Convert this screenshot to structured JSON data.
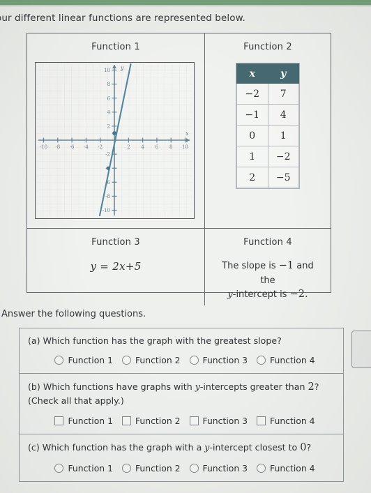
{
  "intro": "our different linear functions are represented below.",
  "functions": {
    "f1_title": "Function 1",
    "f2_title": "Function 2",
    "f3_title": "Function 3",
    "f4_title": "Function 4",
    "f3_equation": "y = 2x+5",
    "f4_line1_a": "The slope is",
    "f4_line1_b": "−1",
    "f4_line1_c": "and the",
    "f4_line2_a": "y",
    "f4_line2_b": "-intercept is",
    "f4_line2_c": "−2."
  },
  "table": {
    "headers": [
      "x",
      "y"
    ],
    "rows": [
      [
        "−2",
        "7"
      ],
      [
        "−1",
        "4"
      ],
      [
        "0",
        "1"
      ],
      [
        "1",
        "−2"
      ],
      [
        "2",
        "−5"
      ]
    ]
  },
  "chart_data": {
    "type": "line",
    "title": "Function 1",
    "xlabel": "x",
    "ylabel": "y",
    "xlim": [
      -10,
      10
    ],
    "ylim": [
      -10,
      10
    ],
    "xticks": [
      -10,
      -8,
      -6,
      -4,
      -2,
      2,
      4,
      6,
      8,
      10
    ],
    "yticks": [
      10,
      8,
      6,
      4,
      2,
      -2,
      -4,
      -6,
      -8,
      -10
    ],
    "grid": true,
    "series": [
      {
        "name": "Function 1",
        "slope": 5,
        "intercept": 1,
        "points": [
          [
            -2,
            -9
          ],
          [
            2,
            11
          ]
        ],
        "marked_points": [
          [
            0,
            1
          ]
        ],
        "color": "#4a7f98"
      }
    ]
  },
  "answer_section": {
    "heading": "Answer the following questions.",
    "questions": [
      {
        "id": "a",
        "text": "(a) Which function has the graph with the greatest slope?",
        "subtext": "",
        "input_type": "radio",
        "options": [
          "Function 1",
          "Function 2",
          "Function 3",
          "Function 4"
        ]
      },
      {
        "id": "b",
        "text": "(b) Which functions have graphs with y-intercepts greater than 2?",
        "text_a": "(b) Which functions have graphs with ",
        "text_ital": "y",
        "text_b": "-intercepts greater than ",
        "text_num": "2",
        "text_c": "?",
        "subtext": "(Check all that apply.)",
        "input_type": "checkbox",
        "options": [
          "Function 1",
          "Function 2",
          "Function 3",
          "Function 4"
        ]
      },
      {
        "id": "c",
        "text": "(c) Which function has the graph with a y-intercept closest to 0?",
        "text_a": "(c) Which function has the graph with a ",
        "text_ital": "y",
        "text_b": "-intercept closest to ",
        "text_num": "0",
        "text_c": "?",
        "subtext": "",
        "input_type": "radio",
        "options": [
          "Function 1",
          "Function 2",
          "Function 3",
          "Function 4"
        ]
      }
    ]
  },
  "colors": {
    "topbar_green": "#6d9b72",
    "table_header": "#3c6169",
    "graph_line": "#4a7f98",
    "page_bg": "#eceeeb"
  }
}
